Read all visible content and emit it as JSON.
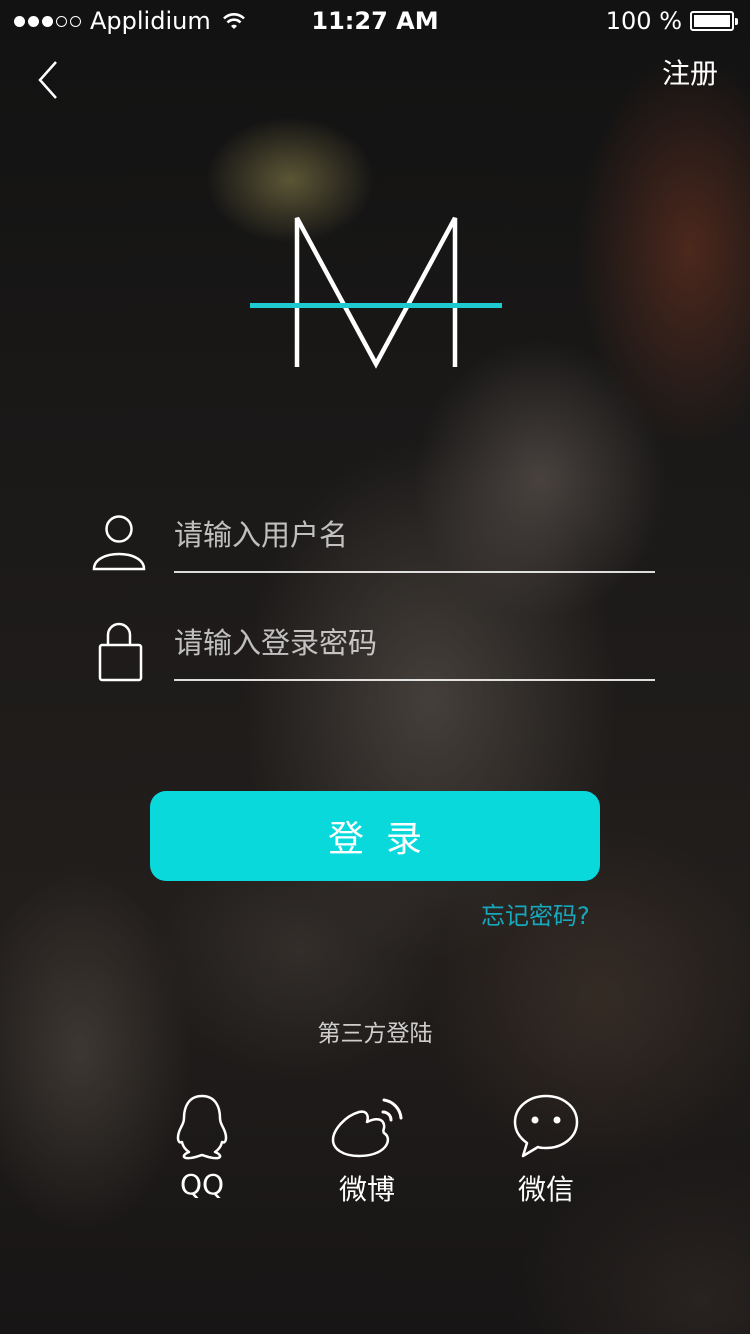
{
  "status_bar": {
    "carrier": "Applidium",
    "time": "11:27 AM",
    "battery": "100 %",
    "battery_level": 1.0,
    "signal_bars_filled": 3,
    "signal_bars_total": 5
  },
  "nav": {
    "back_icon": "chevron-left-icon",
    "register_label": "注册"
  },
  "logo": {
    "letter": "M",
    "accent_color": "#1ec9cf"
  },
  "form": {
    "username": {
      "placeholder": "请输入用户名",
      "value": "",
      "icon": "user-icon"
    },
    "password": {
      "placeholder": "请输入登录密码",
      "value": "",
      "icon": "lock-icon"
    },
    "login_label": "登录",
    "login_color": "#0ad9dc",
    "forgot_label": "忘记密码?"
  },
  "third_party": {
    "title": "第三方登陆",
    "providers": [
      {
        "label": "QQ",
        "icon": "qq-icon"
      },
      {
        "label": "微博",
        "icon": "weibo-icon"
      },
      {
        "label": "微信",
        "icon": "wechat-icon"
      }
    ]
  }
}
